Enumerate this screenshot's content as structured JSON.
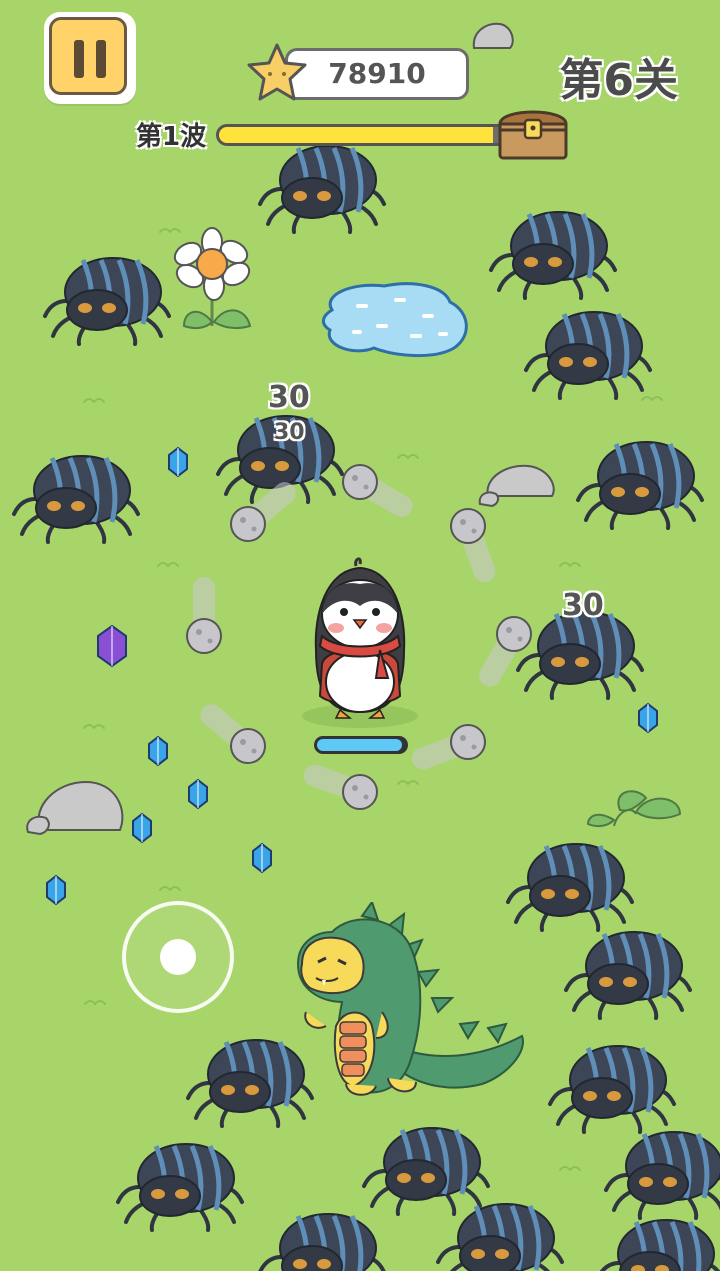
{
  "hud": {
    "pause_label": "",
    "score": "78910",
    "level_label": "第6关",
    "wave_label": "第1波",
    "wave_progress": 0.94
  },
  "damage_numbers": [
    "30",
    "30",
    "30"
  ],
  "player": {
    "hp_fraction": 0.97
  },
  "colors": {
    "grass": "#a8d56a",
    "accent_yellow": "#ffd36a",
    "progress_yellow": "#ffe33b",
    "gem_blue": "#3aa4e8",
    "gem_purple": "#8b4fd6",
    "spider_dark": "#3d4656",
    "spider_stripe": "#5f8fb8"
  },
  "icons": {
    "pause": "pause-icon",
    "star": "star-icon",
    "chest": "treasure-chest-icon",
    "gem": "gem-icon"
  }
}
